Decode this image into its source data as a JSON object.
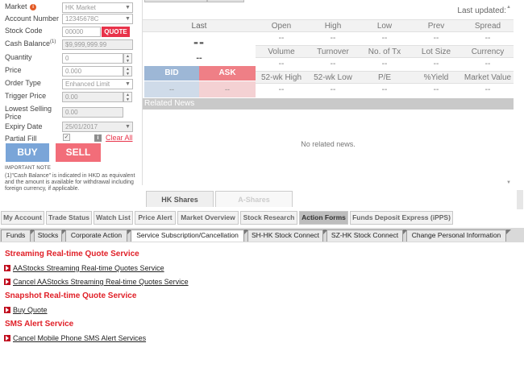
{
  "order_form": {
    "market_label": "Market",
    "market_value": "HK Market",
    "account_label": "Account Number",
    "account_value": "12345678C",
    "stock_code_label": "Stock Code",
    "stock_code_placeholder": "00000",
    "quote_button": "QUOTE",
    "cash_balance_label": "Cash Balance",
    "cash_balance_sup": "(1)",
    "cash_balance_value": "$9,999,999.99",
    "quantity_label": "Quantity",
    "quantity_value": "0",
    "price_label": "Price",
    "price_value": "0.000",
    "order_type_label": "Order Type",
    "order_type_value": "Enhanced Limit",
    "trigger_price_label": "Trigger Price",
    "trigger_price_value": "0.00",
    "lowest_selling_label_1": "Lowest Selling",
    "lowest_selling_label_2": "Price",
    "lowest_selling_value": "0.00",
    "expiry_label": "Expiry Date",
    "expiry_value": "25/01/2017",
    "partial_fill_label": "Partial Fill",
    "partial_fill_check": "✓",
    "info_mark": "i",
    "clear_all": "Clear All",
    "buy_button": "BUY",
    "sell_button": "SELL",
    "important_note_title": "IMPORTANT NOTE",
    "important_note_text": "(1)\"Cash Balance\" is indicated in HKD as equivalent and the amount is available for withdrawal including foreign currency, if applicable."
  },
  "quote": {
    "last_updated": "Last updated:",
    "last_label": "Last",
    "last_value": "--",
    "last_change": "--",
    "bid_label": "BID",
    "ask_label": "ASK",
    "bid_value": "--",
    "ask_value": "--",
    "header_row_1": [
      "Open",
      "High",
      "Low",
      "Prev",
      "Spread"
    ],
    "value_row_1": [
      "--",
      "--",
      "--",
      "--",
      "--"
    ],
    "header_row_2": [
      "Volume",
      "Turnover",
      "No. of Tx",
      "Lot Size",
      "Currency"
    ],
    "value_row_2": [
      "--",
      "--",
      "--",
      "--",
      "--"
    ],
    "header_row_3": [
      "52-wk High",
      "52-wk Low",
      "P/E",
      "%Yield",
      "Market Value"
    ],
    "value_row_3": [
      "--",
      "--",
      "--",
      "--",
      "--"
    ],
    "related_news": "Related News",
    "no_news": "No related news.",
    "market_tabs": [
      "HK Shares",
      "A-Shares"
    ]
  },
  "main_nav": [
    "My Account",
    "Trade Status",
    "Watch List",
    "Price Alert",
    "Market Overview",
    "Stock Research",
    "Action Forms",
    "Funds Deposit Express (iPPS)"
  ],
  "main_nav_active": "Action Forms",
  "sub_nav": [
    "Funds",
    "Stocks",
    "Corporate Action",
    "Service Subscription/Cancellation",
    "SH-HK Stock Connect",
    "SZ-HK Stock Connect",
    "Change Personal Information"
  ],
  "sub_nav_active": "Service Subscription/Cancellation",
  "content": {
    "streaming_title": "Streaming Real-time Quote Service",
    "streaming_links": [
      "AAStocks Streaming Real-time Quotes Service",
      "Cancel AAStocks Streaming Real-time Quotes Service"
    ],
    "snapshot_title": "Snapshot Real-time Quote Service",
    "snapshot_links": [
      "Buy Quote"
    ],
    "sms_title": "SMS Alert Service",
    "sms_links": [
      "Cancel Mobile Phone SMS Alert Services"
    ]
  },
  "colors": {
    "accent_red": "#e02028",
    "buy_blue": "#7aa5d8",
    "sell_pink": "#f26d79"
  }
}
